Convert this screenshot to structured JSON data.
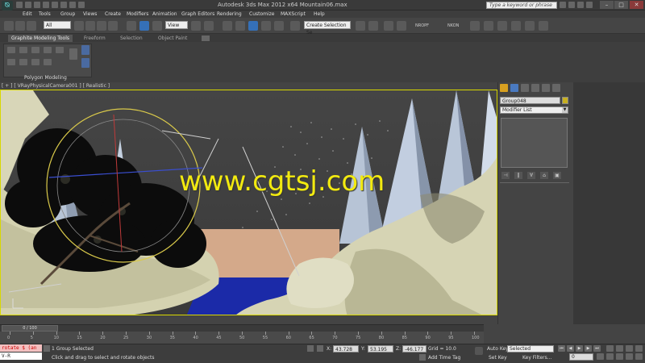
{
  "window": {
    "title": "Autodesk 3ds Max  2012 x64        Mountain06.max",
    "search_placeholder": "Type a keyword or phrase",
    "minimize": "–",
    "maximize": "□",
    "close": "✕"
  },
  "menu": [
    "Edit",
    "Tools",
    "Group",
    "Views",
    "Create",
    "Modifiers",
    "Animation",
    "Graph Editors",
    "Rendering",
    "Customize",
    "MAXScript",
    "Help"
  ],
  "toolbar": {
    "selection_filter": "All",
    "reference_coord": "View",
    "named_selection": "Create Selection Se",
    "nrop": "NROPF",
    "nkon": "NKON"
  },
  "ribbon": {
    "tabs": [
      "Graphite Modeling Tools",
      "Freeform",
      "Selection",
      "Object Paint"
    ],
    "active_tab": 0,
    "panel_label": "Polygon Modeling"
  },
  "viewport": {
    "label": "[ + ] [ VRayPhysicalCamera001 ] [ Realistic ]",
    "watermark": "www.cgtsj.com"
  },
  "command_panel": {
    "object_name": "Group048",
    "modifier_list": "Modifier List",
    "stack_buttons": [
      "⊣",
      "‖",
      "∀",
      "⌂",
      "▣"
    ]
  },
  "timeline": {
    "thumb": "0 / 100",
    "ticks": [
      "0",
      "5",
      "10",
      "15",
      "20",
      "25",
      "30",
      "35",
      "40",
      "45",
      "50",
      "55",
      "60",
      "65",
      "70",
      "75",
      "80",
      "85",
      "90",
      "95",
      "100"
    ]
  },
  "status": {
    "maxscript": "rotate $ (an",
    "maxscript2": "V-R",
    "selection": "1 Group Selected",
    "prompt": "Click and drag to select and rotate objects",
    "x_label": "X:",
    "x_value": "43.728",
    "y_label": "Y:",
    "y_value": "53.195",
    "z_label": "Z:",
    "z_value": "-46.177",
    "grid": "Grid = 10.0",
    "add_time_tag": "Add Time Tag",
    "auto_key": "Auto Key",
    "auto_key_mode": "Selected",
    "set_key": "Set Key",
    "key_filters": "Key Filters...",
    "frame": "0"
  }
}
